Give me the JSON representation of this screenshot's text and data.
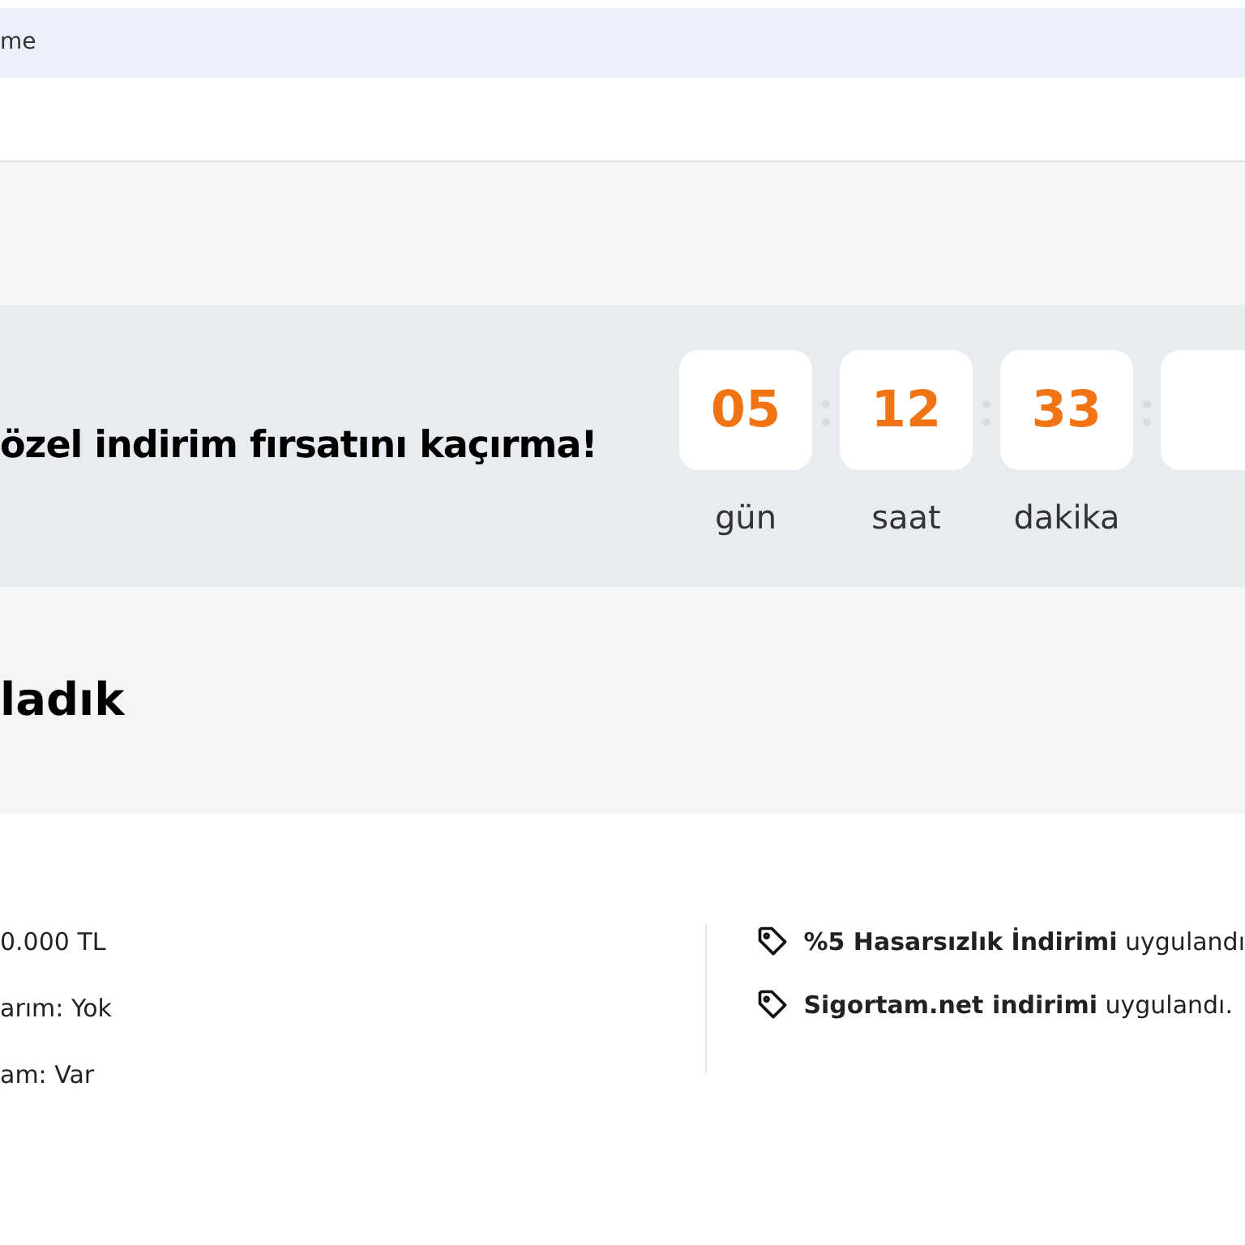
{
  "top_bar": {
    "text": "me"
  },
  "banner": {
    "headline": "özel indirim fırsatını kaçırma!",
    "countdown": [
      {
        "value": "05",
        "unit": "gün"
      },
      {
        "value": "12",
        "unit": "saat"
      },
      {
        "value": "33",
        "unit": "dakika"
      }
    ]
  },
  "section": {
    "title": "ladık"
  },
  "details": [
    "0.000 TL",
    "arım: Yok",
    "am: Var"
  ],
  "discounts": [
    {
      "bold": "%5 Hasarsızlık İndirimi",
      "rest": "uygulandı"
    },
    {
      "bold": "Sigortam.net indirimi",
      "rest": "uygulandı."
    }
  ]
}
